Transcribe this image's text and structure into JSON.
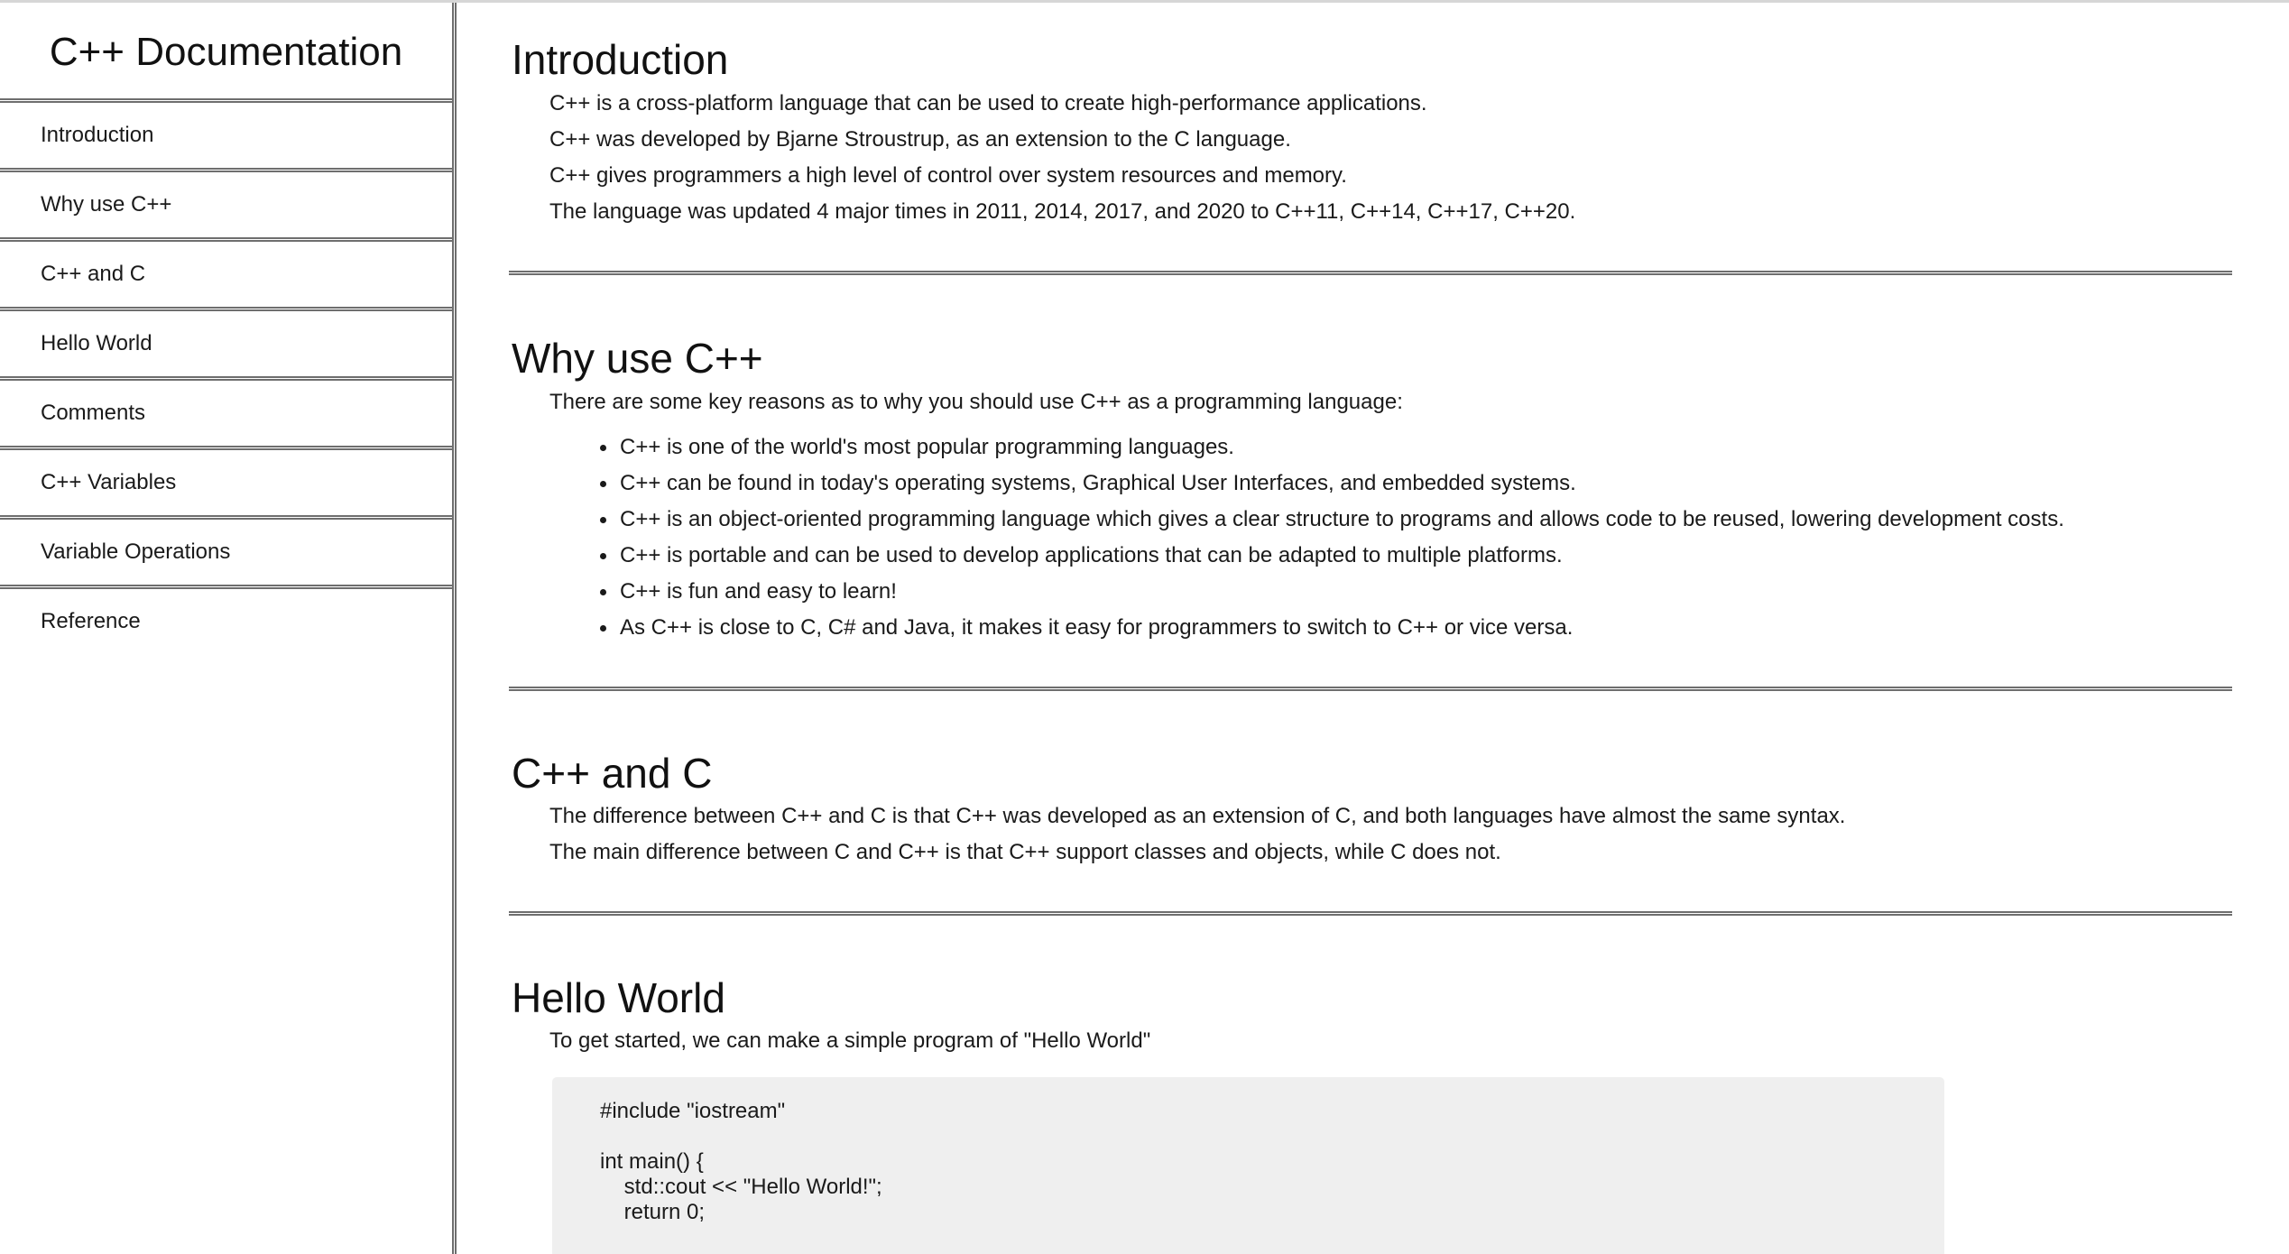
{
  "navbar": {
    "title": "C++ Documentation",
    "items": [
      {
        "label": "Introduction"
      },
      {
        "label": "Why use C++"
      },
      {
        "label": "C++ and C"
      },
      {
        "label": "Hello World"
      },
      {
        "label": "Comments"
      },
      {
        "label": "C++ Variables"
      },
      {
        "label": "Variable Operations"
      },
      {
        "label": "Reference"
      }
    ]
  },
  "sections": {
    "intro": {
      "heading": "Introduction",
      "paragraphs": [
        "C++ is a cross-platform language that can be used to create high-performance applications.",
        "C++ was developed by Bjarne Stroustrup, as an extension to the C language.",
        "C++ gives programmers a high level of control over system resources and memory.",
        "The language was updated 4 major times in 2011, 2014, 2017, and 2020 to C++11, C++14, C++17, C++20."
      ]
    },
    "why": {
      "heading": "Why use C++",
      "intro": "There are some key reasons as to why you should use C++ as a programming language:",
      "bullets": [
        "C++ is one of the world's most popular programming languages.",
        "C++ can be found in today's operating systems, Graphical User Interfaces, and embedded systems.",
        "C++ is an object-oriented programming language which gives a clear structure to programs and allows code to be reused, lowering development costs.",
        "C++ is portable and can be used to develop applications that can be adapted to multiple platforms.",
        "C++ is fun and easy to learn!",
        "As C++ is close to C, C# and Java, it makes it easy for programmers to switch to C++ or vice versa."
      ]
    },
    "cc": {
      "heading": "C++ and C",
      "paragraphs": [
        "The difference between C++ and C is that C++ was developed as an extension of C, and both languages have almost the same syntax.",
        "The main difference between C and C++ is that C++ support classes and objects, while C does not."
      ]
    },
    "hello": {
      "heading": "Hello World",
      "paragraph": "To get started, we can make a simple program of \"Hello World\"",
      "code_lines": [
        "#include \"iostream\"",
        "",
        "int main() {",
        "    std::cout << \"Hello World!\";",
        "    return 0;"
      ]
    }
  }
}
